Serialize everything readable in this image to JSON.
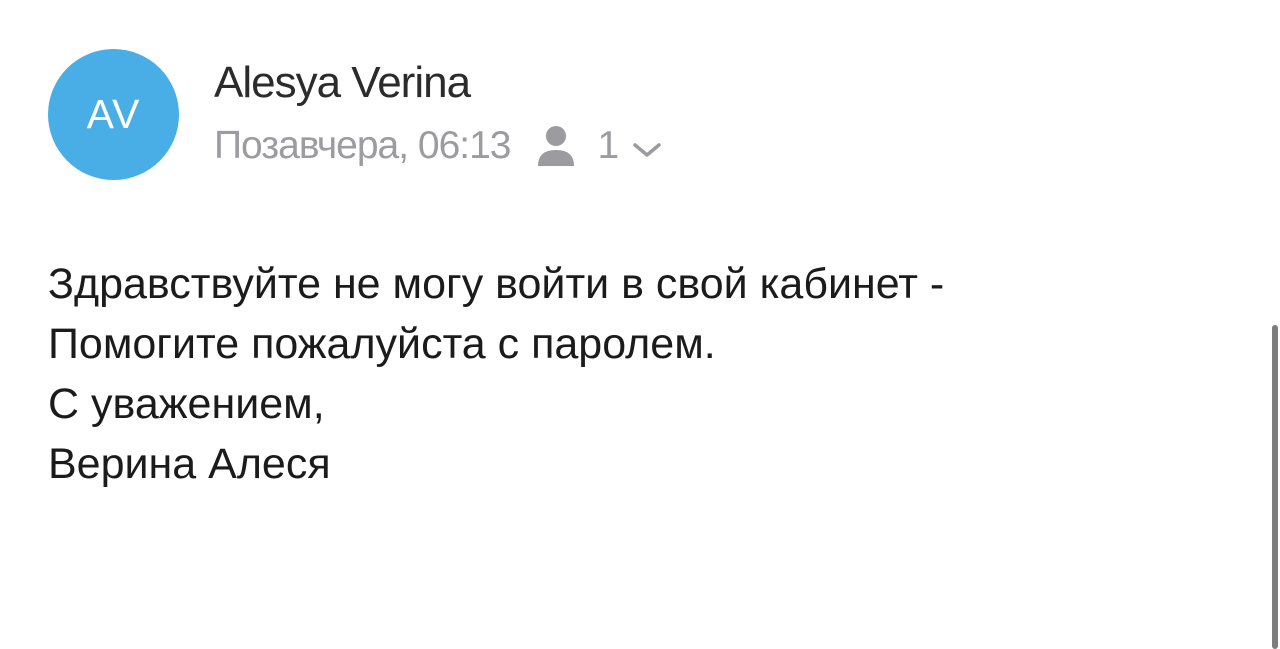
{
  "sender": {
    "avatar_initials": "AV",
    "avatar_color": "#4aaee6",
    "name": "Alesya Verina"
  },
  "meta": {
    "date": "Позавчера, 06:13",
    "recipient_icon": "person-icon",
    "recipient_count": "1",
    "expand_icon": "chevron-down-icon"
  },
  "message": {
    "lines": [
      "Здравствуйте не могу войти в свой кабинет -",
      "Помогите пожалуйста с паролем.",
      "С уважением,",
      "Верина Алеся"
    ]
  }
}
